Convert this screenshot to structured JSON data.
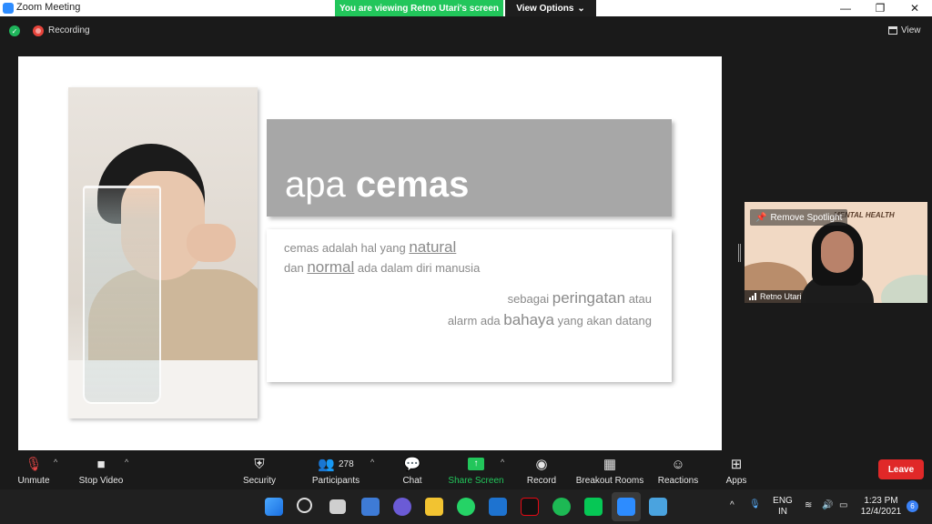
{
  "window": {
    "title": "Zoom Meeting",
    "viewing_banner": "You are viewing Retno Utari's screen",
    "view_options_label": "View Options",
    "minimize": "—",
    "maximize": "❐",
    "close": "✕"
  },
  "header": {
    "recording_label": "Recording",
    "view_label": "View"
  },
  "slide": {
    "headline_light": "apa ",
    "headline_bold": "cemas",
    "line1_pre": "cemas adalah hal yang ",
    "line1_em": "natural",
    "line2_pre": "dan ",
    "line2_em": "normal",
    "line2_post": " ada dalam diri manusia",
    "line3_pre": "sebagai ",
    "line3_em": "peringatan",
    "line3_post": " atau",
    "line4_pre": "alarm ada ",
    "line4_em": "bahaya",
    "line4_post": " yang akan datang"
  },
  "video_tile": {
    "remove_spotlight": "Remove Spotlight",
    "participant_name": "Retno Utari",
    "background_title": "MENTAL HEALTH"
  },
  "toolbar": {
    "unmute": "Unmute",
    "stop_video": "Stop Video",
    "security": "Security",
    "participants": "Participants",
    "participants_count": "278",
    "chat": "Chat",
    "share_screen": "Share Screen",
    "record": "Record",
    "breakout_rooms": "Breakout Rooms",
    "reactions": "Reactions",
    "apps": "Apps",
    "leave": "Leave"
  },
  "taskbar": {
    "lang_top": "ENG",
    "lang_bottom": "IN",
    "time": "1:23 PM",
    "date": "12/4/2021",
    "notifications": "6"
  },
  "colors": {
    "share_green": "#22c65b",
    "leave_red": "#e02828",
    "toolbar_bg": "#1a1a1a",
    "slide_gray": "#a7a7a7"
  }
}
